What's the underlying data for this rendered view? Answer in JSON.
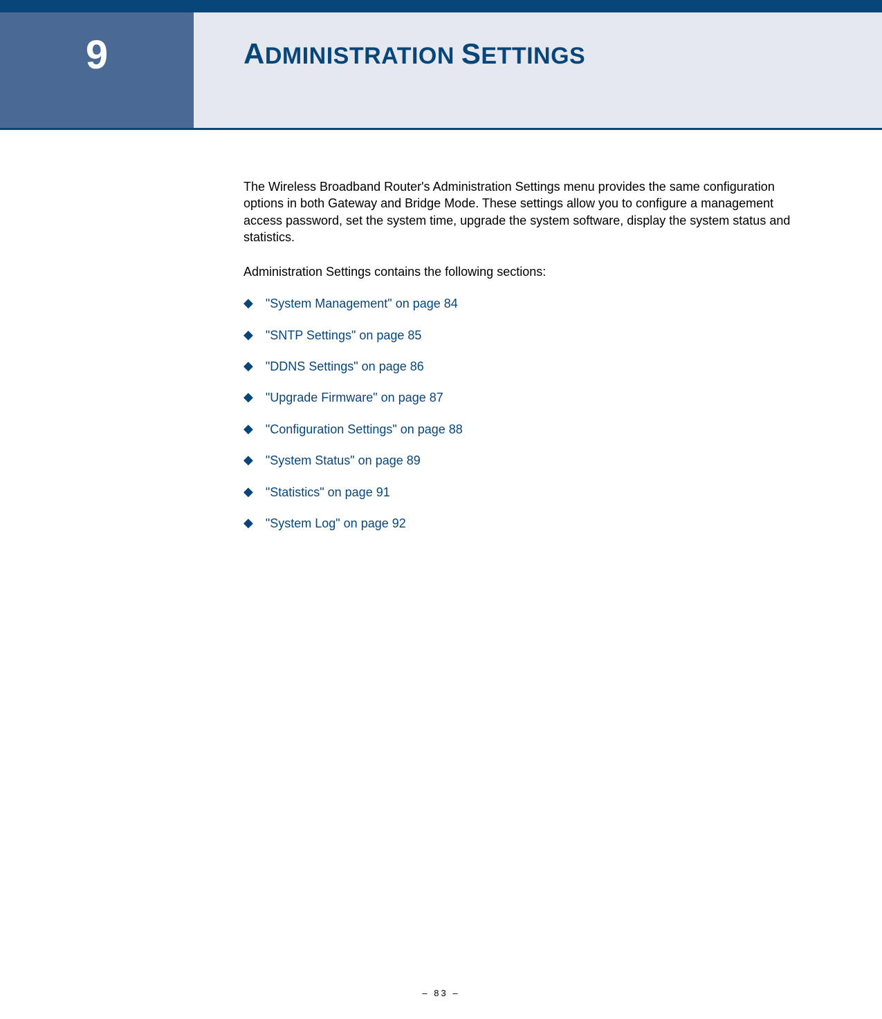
{
  "header": {
    "chapter_number": "9",
    "chapter_title_html": "<span class='cap'>A</span>DMINISTRATION <span class='cap'>S</span>ETTINGS"
  },
  "content": {
    "intro": "The Wireless Broadband Router's Administration Settings menu provides the same configuration options in both Gateway and Bridge Mode. These settings allow you to configure a management access password, set the system time, upgrade the system software, display the system status and statistics.",
    "subheading": "Administration Settings contains the following sections:",
    "toc": [
      {
        "label": "\"System Management\" on page 84"
      },
      {
        "label": "\"SNTP Settings\" on page 85"
      },
      {
        "label": "\"DDNS Settings\" on page 86"
      },
      {
        "label": "\"Upgrade Firmware\" on page 87"
      },
      {
        "label": "\"Configuration Settings\" on page 88"
      },
      {
        "label": "\"System Status\" on page 89"
      },
      {
        "label": "\"Statistics\" on page 91"
      },
      {
        "label": "\"System Log\" on page 92"
      }
    ]
  },
  "footer": {
    "page_label": "–  83  –"
  }
}
